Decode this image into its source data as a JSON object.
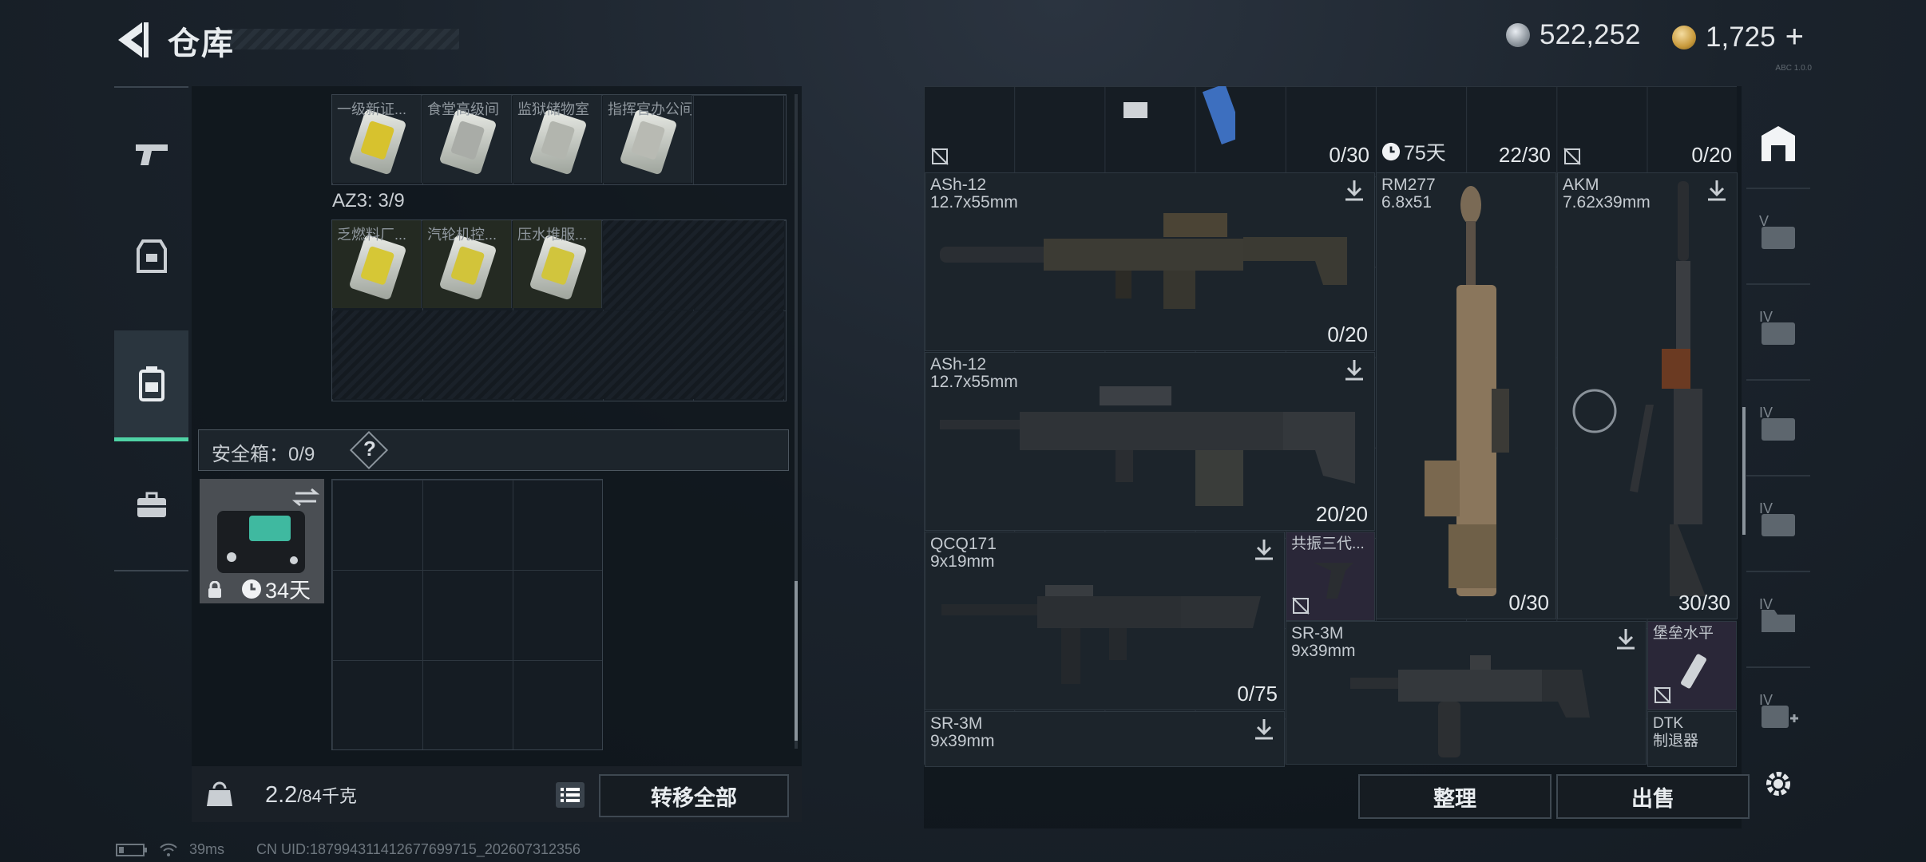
{
  "header": {
    "title": "仓库",
    "currency_silver": "522,252",
    "currency_gold": "1,725",
    "plus": "+",
    "tiny_text": "ABC 1.0.0"
  },
  "nav": {
    "items": [
      {
        "name": "weapons",
        "icon": "pistol-icon"
      },
      {
        "name": "gear",
        "icon": "armor-icon"
      },
      {
        "name": "backpack",
        "icon": "backpack-icon"
      },
      {
        "name": "case",
        "icon": "briefcase-icon"
      }
    ]
  },
  "left": {
    "row1": [
      "一级新证...",
      "食堂高级间",
      "监狱储物室",
      "指挥官办公间"
    ],
    "az3_label": "AZ3: 3/9",
    "row2": [
      "乏燃料厂...",
      "汽轮机控...",
      "压水堆服..."
    ],
    "safe_label": "安全箱：0/9",
    "safe_help": "?",
    "safe_days": "34天",
    "weight_value": "2.2",
    "weight_max": "/84千克",
    "transfer_all": "转移全部"
  },
  "right": {
    "items": [
      {
        "name": "ASh-12",
        "caliber": "12.7x55mm",
        "count": "0/20"
      },
      {
        "name": "ASh-12",
        "caliber": "12.7x55mm",
        "count": "20/20"
      },
      {
        "name": "QCQ171",
        "caliber": "9x19mm",
        "count": "0/75"
      },
      {
        "name": "SR-3M",
        "caliber": "9x39mm",
        "count": ""
      },
      {
        "name": "RM277",
        "caliber": "6.8x51",
        "count": "0/30"
      },
      {
        "name": "AKM",
        "caliber": "7.62x39mm",
        "count": "30/30"
      },
      {
        "name": "共振三代...",
        "caliber": "",
        "count": ""
      },
      {
        "name": "SR-3M",
        "caliber": "9x39mm",
        "count": ""
      },
      {
        "name": "堡垒水平",
        "caliber": "",
        "count": ""
      },
      {
        "name": "DTK",
        "caliber": "制退器",
        "count": ""
      }
    ],
    "top_counts": [
      "0/30",
      "22/30",
      "0/20"
    ],
    "top_timer": "75天",
    "sort": "整理",
    "sell": "出售"
  },
  "sidebar": {
    "labels": [
      "V",
      "IV",
      "IV",
      "IV",
      "IV",
      "IV"
    ]
  },
  "status": {
    "ping": "39ms",
    "uid": "CN UID:187994311412677699715_202607312356"
  }
}
